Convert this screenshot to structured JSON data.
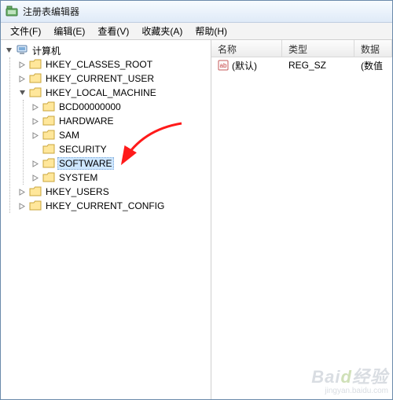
{
  "window": {
    "title": "注册表编辑器"
  },
  "menu": {
    "file": "文件(F)",
    "edit": "编辑(E)",
    "view": "查看(V)",
    "favorites": "收藏夹(A)",
    "help": "帮助(H)"
  },
  "tree": {
    "root": "计算机",
    "hkcr": "HKEY_CLASSES_ROOT",
    "hkcu": "HKEY_CURRENT_USER",
    "hklm": "HKEY_LOCAL_MACHINE",
    "hklm_children": {
      "bcd": "BCD00000000",
      "hardware": "HARDWARE",
      "sam": "SAM",
      "security": "SECURITY",
      "software": "SOFTWARE",
      "system": "SYSTEM"
    },
    "hku": "HKEY_USERS",
    "hkcc": "HKEY_CURRENT_CONFIG"
  },
  "list": {
    "headers": {
      "name": "名称",
      "type": "类型",
      "data": "数据"
    },
    "rows": [
      {
        "name": "(默认)",
        "type": "REG_SZ",
        "data": "(数值"
      }
    ]
  },
  "watermark": {
    "brand_a": "Bai",
    "brand_b": "d",
    "brand_c": "经验",
    "url": "jingyan.baidu.com"
  }
}
